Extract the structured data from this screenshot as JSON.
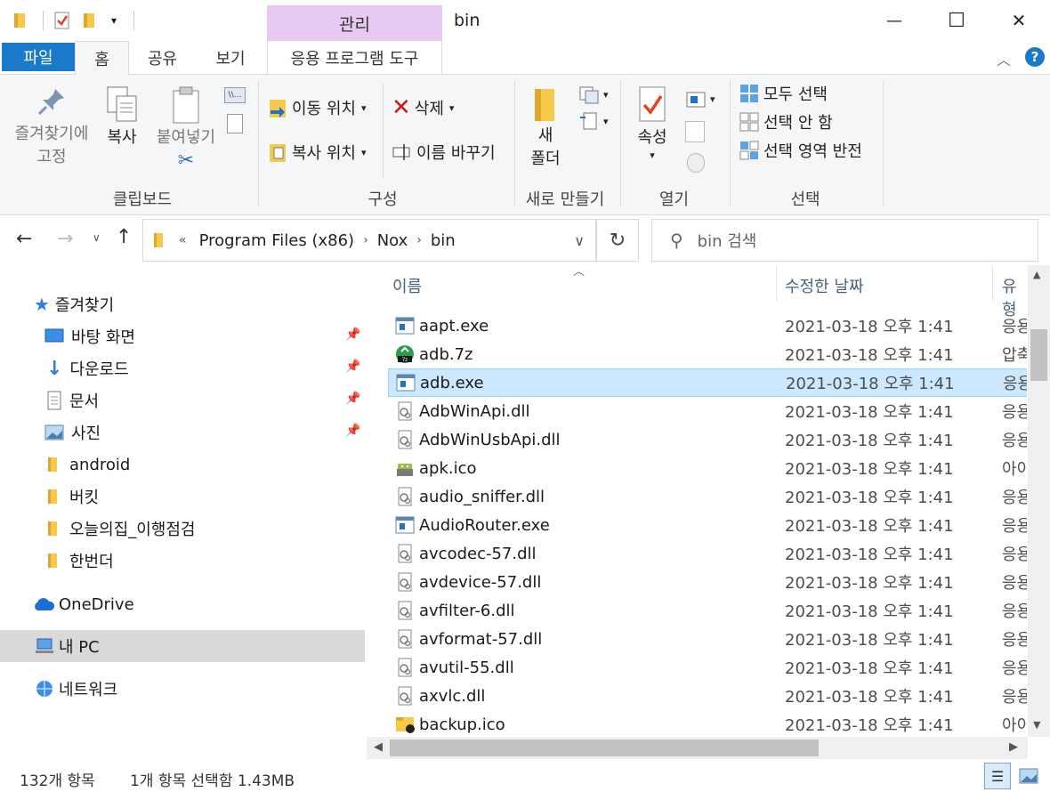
{
  "titlebar": {
    "contextual_tab": "관리",
    "window_title": "bin",
    "minimize": "—",
    "maximize": "☐",
    "close": "✕"
  },
  "tabs": {
    "file": "파일",
    "home": "홈",
    "share": "공유",
    "view": "보기",
    "app_tools": "응용 프로그램 도구"
  },
  "ribbon": {
    "clipboard": {
      "pin_quick": "즐겨찾기에\n고정",
      "pin_line1": "즐겨찾기에",
      "pin_line2": "고정",
      "copy": "복사",
      "paste": "붙여넣기",
      "label": "클립보드"
    },
    "organize": {
      "move_to": "이동 위치",
      "copy_to": "복사 위치",
      "delete": "삭제",
      "rename": "이름 바꾸기",
      "label": "구성"
    },
    "new": {
      "new_folder_line1": "새",
      "new_folder_line2": "폴더",
      "label": "새로 만들기"
    },
    "open": {
      "properties": "속성",
      "label": "열기"
    },
    "select": {
      "select_all": "모두 선택",
      "select_none": "선택 안 함",
      "invert": "선택 영역 반전",
      "label": "선택"
    }
  },
  "address": {
    "chevron": "«",
    "crumbs": [
      "Program Files (x86)",
      "Nox",
      "bin"
    ],
    "search_placeholder": "bin 검색"
  },
  "nav": {
    "quick_access": "즐겨찾기",
    "items": [
      {
        "label": "바탕 화면",
        "pinned": true
      },
      {
        "label": "다운로드",
        "pinned": true
      },
      {
        "label": "문서",
        "pinned": true
      },
      {
        "label": "사진",
        "pinned": true
      },
      {
        "label": "android",
        "pinned": false
      },
      {
        "label": "버킷",
        "pinned": false
      },
      {
        "label": "오늘의집_이행점검",
        "pinned": false
      },
      {
        "label": "한번더",
        "pinned": false
      }
    ],
    "onedrive": "OneDrive",
    "this_pc": "내 PC",
    "network": "네트워크"
  },
  "columns": {
    "name": "이름",
    "date": "수정한 날짜",
    "type": "유형"
  },
  "files": [
    {
      "name": "aapt.exe",
      "date": "2021-03-18 오후 1:41",
      "type": "응용",
      "icon": "exe-icon"
    },
    {
      "name": "adb.7z",
      "date": "2021-03-18 오후 1:41",
      "type": "압축",
      "icon": "archive-icon"
    },
    {
      "name": "adb.exe",
      "date": "2021-03-18 오후 1:41",
      "type": "응용",
      "icon": "exe-icon",
      "selected": true
    },
    {
      "name": "AdbWinApi.dll",
      "date": "2021-03-18 오후 1:41",
      "type": "응용",
      "icon": "dll-icon"
    },
    {
      "name": "AdbWinUsbApi.dll",
      "date": "2021-03-18 오후 1:41",
      "type": "응용",
      "icon": "dll-icon"
    },
    {
      "name": "apk.ico",
      "date": "2021-03-18 오후 1:41",
      "type": "아이",
      "icon": "android-icon"
    },
    {
      "name": "audio_sniffer.dll",
      "date": "2021-03-18 오후 1:41",
      "type": "응용",
      "icon": "dll-icon"
    },
    {
      "name": "AudioRouter.exe",
      "date": "2021-03-18 오후 1:41",
      "type": "응용",
      "icon": "exe-icon"
    },
    {
      "name": "avcodec-57.dll",
      "date": "2021-03-18 오후 1:41",
      "type": "응용",
      "icon": "dll-icon"
    },
    {
      "name": "avdevice-57.dll",
      "date": "2021-03-18 오후 1:41",
      "type": "응용",
      "icon": "dll-icon"
    },
    {
      "name": "avfilter-6.dll",
      "date": "2021-03-18 오후 1:41",
      "type": "응용",
      "icon": "dll-icon"
    },
    {
      "name": "avformat-57.dll",
      "date": "2021-03-18 오후 1:41",
      "type": "응용",
      "icon": "dll-icon"
    },
    {
      "name": "avutil-55.dll",
      "date": "2021-03-18 오후 1:41",
      "type": "응용",
      "icon": "dll-icon"
    },
    {
      "name": "axvlc.dll",
      "date": "2021-03-18 오후 1:41",
      "type": "응용",
      "icon": "dll-icon"
    },
    {
      "name": "backup.ico",
      "date": "2021-03-18 오후 1:41",
      "type": "아이",
      "icon": "backup-folder-icon"
    }
  ],
  "status": {
    "count": "132개 항목",
    "selection": "1개 항목 선택함 1.43MB"
  },
  "colors": {
    "file_tab": "#1979ca",
    "manage_tab": "#e8c9f2",
    "selection": "#cce8ff",
    "nav_selected": "#d9d9d9"
  }
}
